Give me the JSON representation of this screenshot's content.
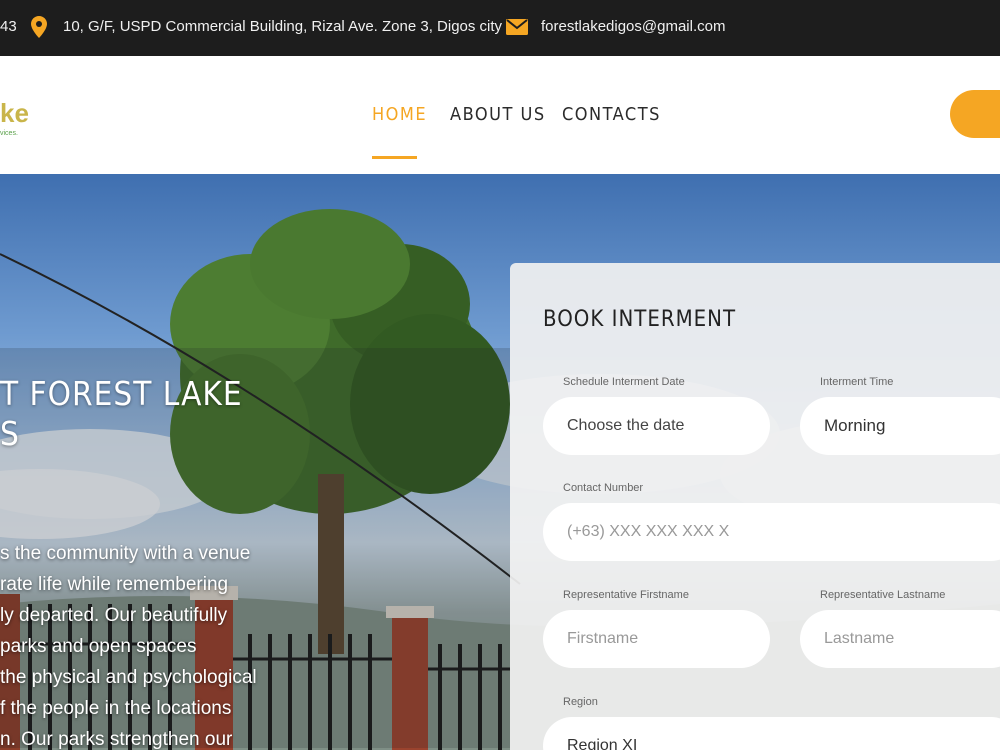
{
  "topbar": {
    "phone_partial": "43",
    "address": "10, G/F, USPD Commercial Building, Rizal Ave. Zone 3, Digos city",
    "email": "forestlakedigos@gmail.com"
  },
  "header": {
    "logo_text": "ke",
    "logo_tagline": "vices.",
    "nav": [
      {
        "label": "HOME",
        "active": true
      },
      {
        "label": "ABOUT US",
        "active": false
      },
      {
        "label": "CONTACTS",
        "active": false
      }
    ]
  },
  "hero": {
    "title_line1": "T FOREST LAKE",
    "title_line2": "S",
    "body_lines": [
      "s the community with a venue",
      "rate life while remembering",
      "ly departed. Our beautifully",
      " parks and open spaces",
      " the physical and psychological",
      "f the people in the locations",
      "n. Our parks strengthen our"
    ]
  },
  "booking": {
    "title": "BOOK INTERMENT",
    "date_label": "Schedule Interment Date",
    "date_placeholder": "Choose the date",
    "time_label": "Interment Time",
    "time_value": "Morning",
    "contact_label": "Contact Number",
    "contact_placeholder": "(+63) XXX XXX XXX X",
    "firstname_label": "Representative Firstname",
    "firstname_placeholder": "Firstname",
    "lastname_label": "Representative Lastname",
    "lastname_placeholder": "Lastname",
    "region_label": "Region",
    "region_value": "Region XI"
  },
  "colors": {
    "accent": "#f5a623",
    "topbar_bg": "#1d1d1d"
  }
}
